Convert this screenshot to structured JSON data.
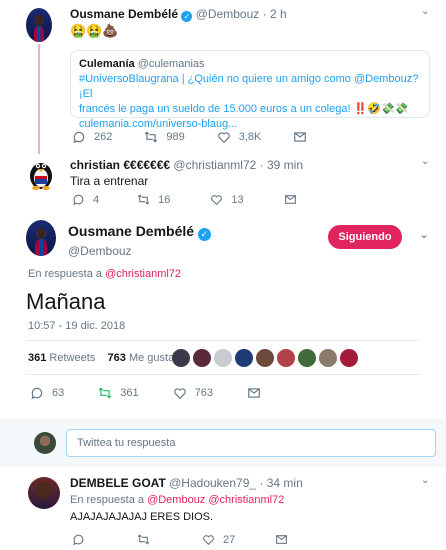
{
  "tweet1": {
    "name": "Ousmane Dembélé",
    "handle": "@Dembouz",
    "time": "· 2 h",
    "emojis": [
      "🤮",
      "🤮",
      "💩"
    ],
    "quote": {
      "name": "Culemanía",
      "handle": "@culemanias",
      "text_line1": "#UniversoBlaugrana | ¿Quién no quiere un amigo como @Dembouz? ¡El",
      "text_line2": "francés le paga un sueldo de 15.000 euros a un colega!",
      "text_line2_emojis": "‼️🤣💸💸",
      "text_line3": "culemania.com/universo-blaug..."
    },
    "replies": "262",
    "retweets": "989",
    "likes": "3,8K"
  },
  "tweet2": {
    "name": "christian €€€€€€€",
    "handle": "@christianml72",
    "time": "· 39 min",
    "text": "Tira a entrenar",
    "replies": "4",
    "retweets": "16",
    "likes": "13"
  },
  "main_tweet": {
    "name": "Ousmane Dembélé",
    "handle": "@Dembouz",
    "follow_label": "Siguiendo",
    "in_reply_prefix": "En respuesta a",
    "in_reply_to": "@christianml72",
    "text": "Mañana",
    "timestamp": "10:57 - 19 dic. 2018",
    "retweets_count": "361",
    "retweets_label": "Retweets",
    "likes_count": "763",
    "likes_label": "Me gusta",
    "action_replies": "63",
    "action_retweets": "361",
    "action_likes": "763"
  },
  "reply_compose": {
    "placeholder": "Twittea tu respuesta"
  },
  "tweet3": {
    "name": "DEMBELE GOAT",
    "handle": "@Hadouken79_",
    "time": "· 34 min",
    "in_reply_prefix": "En respuesta a",
    "in_reply_to_1": "@Dembouz",
    "in_reply_to_2": "@christianml72",
    "text": "AJAJAJAJAJAJ ERES DIOS.",
    "replies": "",
    "retweets": "",
    "likes": "27"
  },
  "colors": {
    "accent": "#1da1f2",
    "follow": "#e0245e",
    "muted": "#657786"
  }
}
